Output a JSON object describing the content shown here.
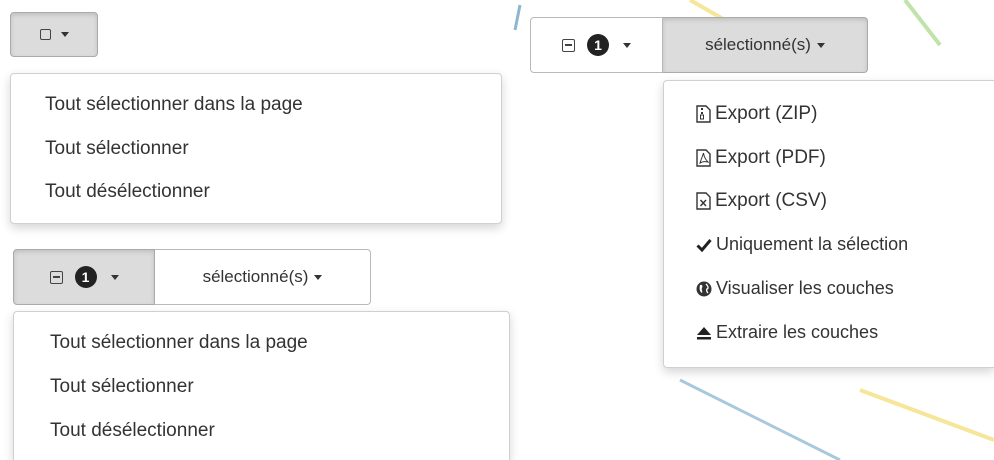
{
  "select_menu_top": {
    "items": [
      "Tout sélectionner dans la page",
      "Tout sélectionner",
      "Tout désélectionner"
    ]
  },
  "select_menu_bottom": {
    "count": "1",
    "selected_label": "sélectionné(s)",
    "items": [
      "Tout sélectionner dans la page",
      "Tout sélectionner",
      "Tout désélectionner"
    ]
  },
  "actions_menu": {
    "count": "1",
    "selected_label": "sélectionné(s)",
    "items": [
      {
        "icon": "zip-file-icon",
        "label": "Export (ZIP)"
      },
      {
        "icon": "pdf-file-icon",
        "label": "Export (PDF)"
      },
      {
        "icon": "csv-file-icon",
        "label": "Export (CSV)"
      },
      {
        "icon": "check-icon",
        "label": "Uniquement la sélection"
      },
      {
        "icon": "globe-icon",
        "label": "Visualiser les couches"
      },
      {
        "icon": "eject-icon",
        "label": "Extraire les couches"
      }
    ]
  }
}
